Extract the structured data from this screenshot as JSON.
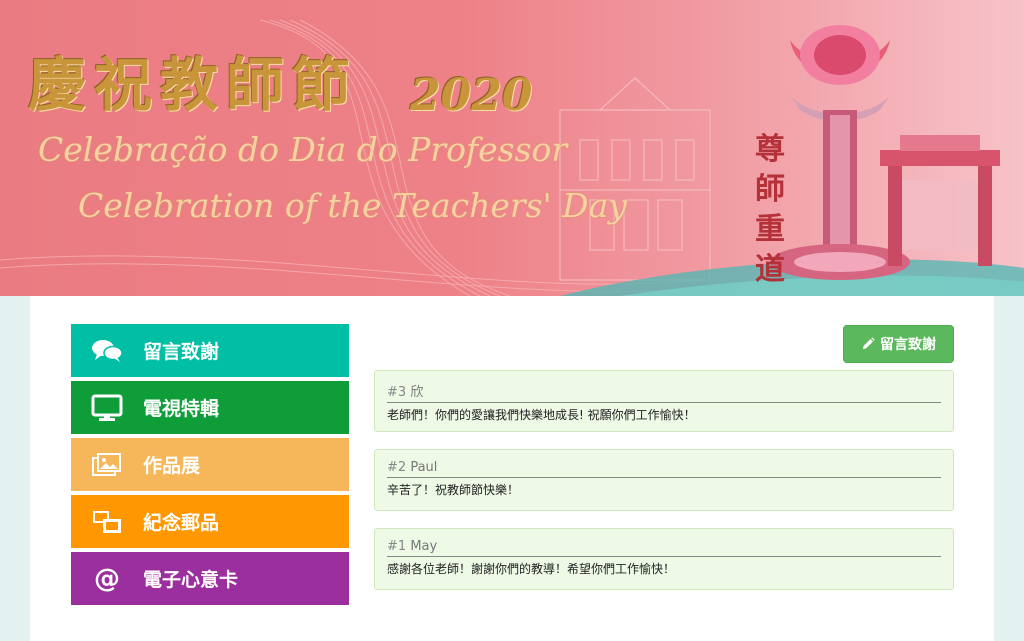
{
  "banner": {
    "title_cn": "慶祝教師節",
    "year": "2020",
    "subtitle_pt": "Celebração do Dia do Professor",
    "subtitle_en": "Celebration of the Teachers' Day",
    "vertical_text": "尊師重道"
  },
  "menu": [
    {
      "label": "留言致謝",
      "color": "#00bfa5",
      "icon": "chat-bubbles-icon"
    },
    {
      "label": "電視特輯",
      "color": "#0f9d3a",
      "icon": "monitor-icon"
    },
    {
      "label": "作品展",
      "color": "#f6b65a",
      "icon": "photo-icon"
    },
    {
      "label": "紀念郵品",
      "color": "#ff9800",
      "icon": "stamps-icon"
    },
    {
      "label": "電子心意卡",
      "color": "#9c2f9e",
      "icon": "at-icon",
      "glyph": "@"
    }
  ],
  "post_button": {
    "label": "留言致謝",
    "icon": "pencil-icon",
    "color": "#5cb85c"
  },
  "messages": [
    {
      "num": "#3",
      "name": "欣",
      "text": "老師們！你們的愛讓我們快樂地成長! 祝願你們工作愉快！"
    },
    {
      "num": "#2",
      "name": "Paul",
      "text": "辛苦了！祝教師節快樂！"
    },
    {
      "num": "#1",
      "name": "May",
      "text": "感謝各位老師！謝謝你們的教導！希望你們工作愉快！"
    }
  ]
}
